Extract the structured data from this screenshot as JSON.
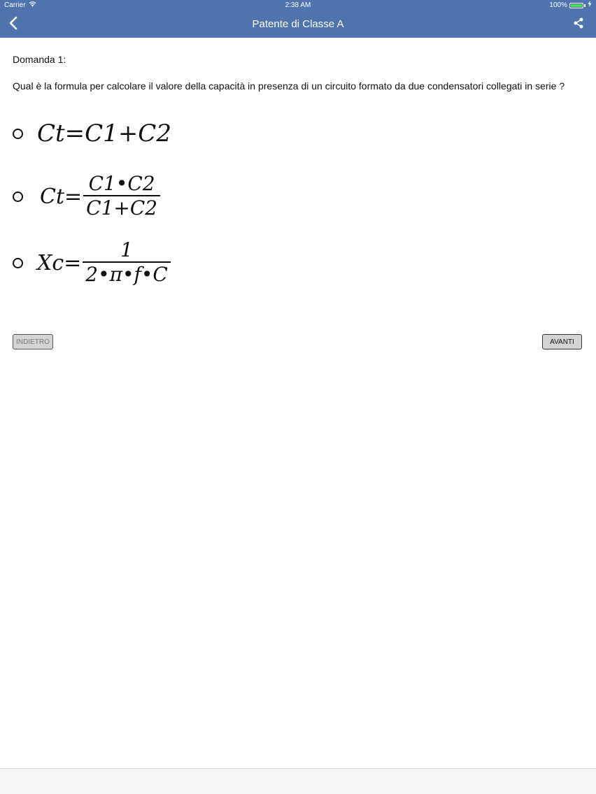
{
  "status_bar": {
    "carrier": "Carrier",
    "time": "2:38 AM",
    "battery": "100%"
  },
  "nav": {
    "title": "Patente di Classe A",
    "back_icon": "chevron-left-icon",
    "share_icon": "share-icon"
  },
  "question": {
    "number_label": "Domanda 1:",
    "text": "Qual è la formula per calcolare il valore della capacità in presenza di un circuito formato da due condensatori collegati in serie ?"
  },
  "options": [
    {
      "formula": "Ct=C1+C2"
    },
    {
      "lhs": "Ct=",
      "numerator": "C1•C2",
      "denominator": "C1+C2"
    },
    {
      "lhs": "Xc=",
      "numerator": "1",
      "denominator": "2•π•f•C"
    }
  ],
  "buttons": {
    "back_label": "INDIETRO",
    "next_label": "AVANTI"
  },
  "colors": {
    "nav_background": "#4f74ad",
    "battery": "#4cd964"
  }
}
